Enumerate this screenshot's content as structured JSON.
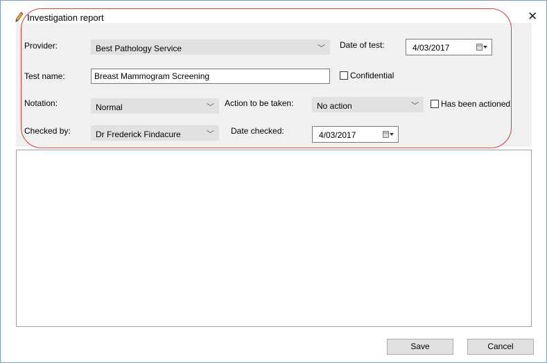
{
  "window": {
    "title": "Investigation report",
    "close_glyph": "✕",
    "icon": "pencil-icon"
  },
  "form": {
    "provider": {
      "label": "Provider:",
      "value": "Best Pathology Service"
    },
    "date_of_test": {
      "label": "Date of test:",
      "value": "4/03/2017"
    },
    "test_name": {
      "label": "Test name:",
      "value": "Breast Mammogram Screening"
    },
    "confidential": {
      "label": "Confidential",
      "checked": false
    },
    "notation": {
      "label": "Notation:",
      "value": "Normal"
    },
    "action": {
      "label": "Action to be taken:",
      "value": "No action"
    },
    "has_been_actioned": {
      "label": "Has been actioned",
      "checked": false
    },
    "checked_by": {
      "label": "Checked by:",
      "value": "Dr Frederick Findacure"
    },
    "date_checked": {
      "label": "Date checked:",
      "value": "4/03/2017"
    }
  },
  "notes": {
    "value": ""
  },
  "buttons": {
    "save": "Save",
    "cancel": "Cancel"
  },
  "colors": {
    "highlight": "#e53935",
    "window_border": "#7a9cc6",
    "form_bg": "#f0f0f0",
    "control_bg": "#e1e1e1"
  }
}
